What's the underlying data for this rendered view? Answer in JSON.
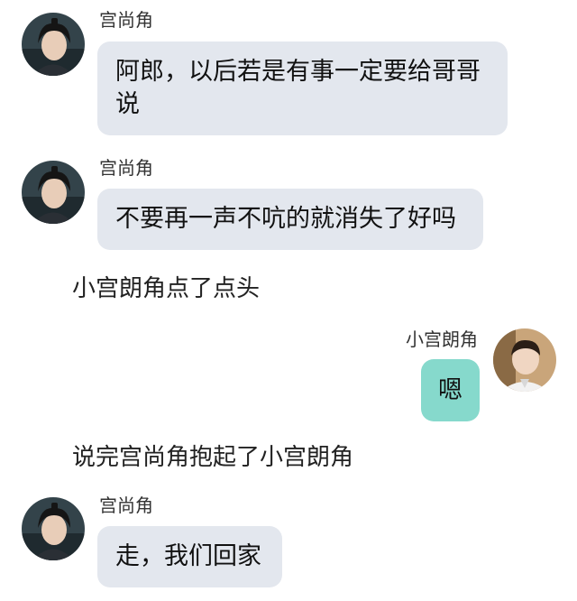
{
  "messages": [
    {
      "sender": "宫尚角",
      "text": "阿郎，以后若是有事一定要给哥哥说",
      "avatar_icon": "dark-haired-man-avatar"
    },
    {
      "sender": "宫尚角",
      "text": "不要再一声不吭的就消失了好吗",
      "avatar_icon": "dark-haired-man-avatar"
    },
    {
      "narration": "小宫朗角点了点头"
    },
    {
      "sender": "小宫朗角",
      "text": "嗯",
      "avatar_icon": "young-boy-avatar"
    },
    {
      "narration": "说完宫尚角抱起了小宫朗角"
    },
    {
      "sender": "宫尚角",
      "text": "走，我们回家",
      "avatar_icon": "dark-haired-man-avatar"
    }
  ],
  "colors": {
    "left_bubble": "#e3e7ee",
    "right_bubble": "#86d9cc"
  }
}
